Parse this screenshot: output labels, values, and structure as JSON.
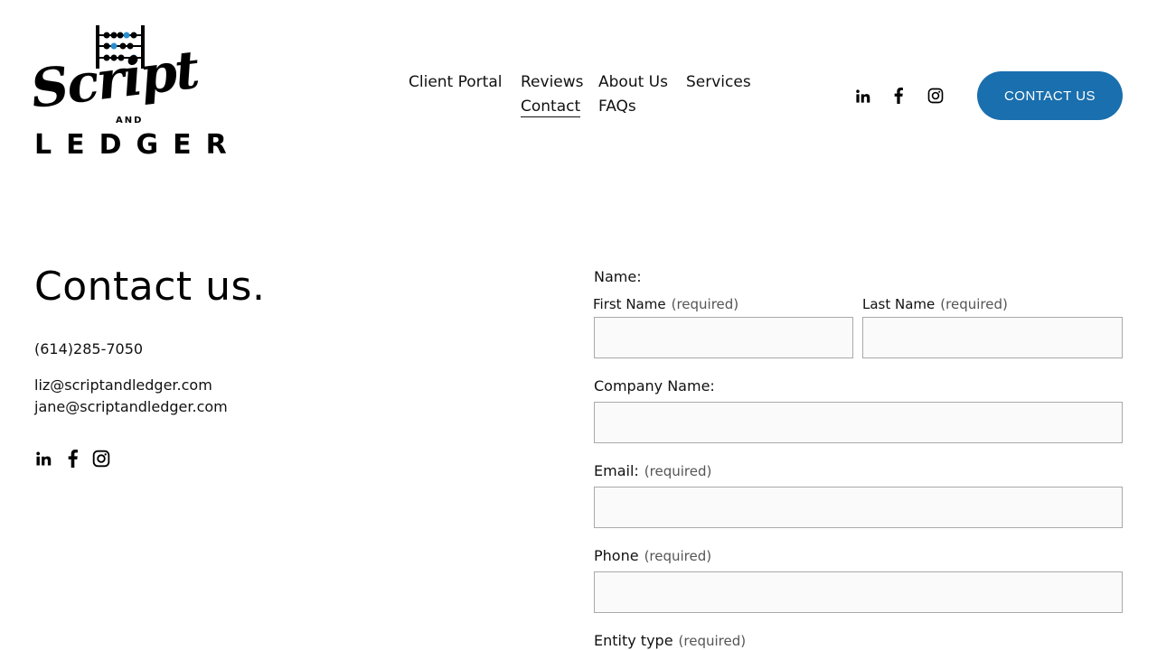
{
  "brand": {
    "script": "Script",
    "and": "AND",
    "ledger": "LEDGER"
  },
  "nav": {
    "items": [
      {
        "label": "Client Portal"
      },
      {
        "label": "Reviews"
      },
      {
        "label": "About Us"
      },
      {
        "label": "Services"
      },
      {
        "label": "Contact",
        "active": true
      },
      {
        "label": "FAQs"
      }
    ],
    "social": [
      "linkedin-icon",
      "facebook-icon",
      "instagram-icon"
    ],
    "cta_label": "CONTACT US"
  },
  "contact": {
    "title": "Contact us.",
    "phone": "(614)285-7050",
    "emails": [
      "liz@scriptandledger.com",
      "jane@scriptandledger.com"
    ],
    "social": [
      "linkedin-icon",
      "facebook-icon",
      "instagram-icon"
    ]
  },
  "form": {
    "name_label": "Name:",
    "first_name_label": "First Name",
    "last_name_label": "Last Name",
    "required_text": "(required)",
    "company_label": "Company Name:",
    "email_label": "Email:",
    "phone_label": "Phone",
    "entity_label": "Entity type",
    "first_name_value": "",
    "last_name_value": "",
    "company_value": "",
    "email_value": "",
    "phone_value": ""
  },
  "colors": {
    "accent": "#1a6fae",
    "abacus_bead": "#2a8fd0",
    "field_bg": "#fafafa",
    "field_border": "#a9a9a9"
  }
}
